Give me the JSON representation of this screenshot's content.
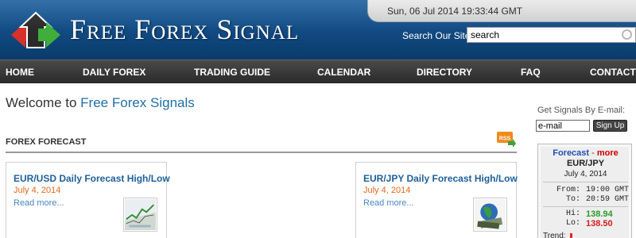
{
  "header": {
    "site_title": "Free Forex Signal",
    "datetime": "Sun, 06 Jul 2014 19:33:44 GMT",
    "search_label": "Search Our Site:",
    "search_value": "search"
  },
  "nav": {
    "items": [
      "HOME",
      "DAILY FOREX",
      "TRADING GUIDE",
      "CALENDAR",
      "DIRECTORY",
      "FAQ",
      "CONTACT"
    ]
  },
  "main": {
    "welcome_prefix": "Welcome to ",
    "welcome_brand": "Free Forex Signals",
    "section_title": "FOREX FORECAST",
    "rss_label": "RSS",
    "cards": [
      {
        "title": "EUR/USD Daily Forecast High/Low",
        "date": "July 4, 2014",
        "read_more": "Read more..."
      },
      {
        "title": "EUR/JPY Daily Forecast High/Low",
        "date": "July 4, 2014",
        "read_more": "Read more..."
      }
    ]
  },
  "sidebar": {
    "signals_label": "Get Signals By E-mail:",
    "email_value": "e-mail",
    "signup_label": "Sign Up",
    "widget": {
      "forecast": "Forecast",
      "dash": " - ",
      "more": "more",
      "pair": "EUR/JPY",
      "date": "July 4, 2014",
      "from_label": "From:",
      "from_value": "19:00 GMT",
      "to_label": "To:",
      "to_value": "20:59 GMT",
      "hi_label": "Hi:",
      "hi_value": "138.94",
      "lo_label": "Lo:",
      "lo_value": "138.50",
      "trend_label": "Trend:"
    }
  },
  "colors": {
    "header_blue": "#0e4479",
    "nav_dark": "#2a2a2a",
    "link_blue": "#1f5f98",
    "date_orange": "#e2691f",
    "hi_green": "#2b9a2b",
    "lo_red": "#d02020"
  }
}
